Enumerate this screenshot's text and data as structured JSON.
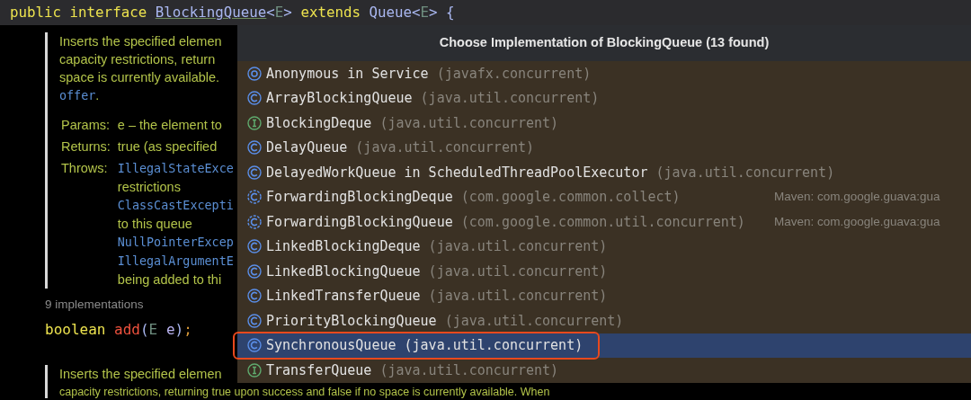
{
  "code_header": [
    {
      "t": "public interface ",
      "kind": "keyword"
    },
    {
      "t": "BlockingQueue",
      "kind": "type_link"
    },
    {
      "t": "<",
      "kind": "punct"
    },
    {
      "t": "E",
      "kind": "typeparam"
    },
    {
      "t": "> ",
      "kind": "punct"
    },
    {
      "t": "extends ",
      "kind": "keyword"
    },
    {
      "t": "Queue",
      "kind": "type"
    },
    {
      "t": "<",
      "kind": "punct"
    },
    {
      "t": "E",
      "kind": "typeparam"
    },
    {
      "t": "> {",
      "kind": "punct"
    }
  ],
  "doc_block": {
    "lines": [
      [
        {
          "t": "Inserts the specified elemen",
          "kind": "doc"
        }
      ],
      [
        {
          "t": "capacity restrictions, return",
          "kind": "doc"
        }
      ],
      [
        {
          "t": "space is currently available.",
          "kind": "doc"
        }
      ],
      [
        {
          "t": "offer",
          "kind": "code"
        },
        {
          "t": ".",
          "kind": "doc"
        }
      ]
    ],
    "tags": [
      {
        "label": "Params:",
        "lines": [
          [
            {
              "t": "e – the element to",
              "kind": "doc"
            }
          ]
        ]
      },
      {
        "label": "Returns:",
        "lines": [
          [
            {
              "t": "true (as specified",
              "kind": "doc"
            }
          ]
        ]
      },
      {
        "label": "Throws:",
        "lines": [
          [
            {
              "t": "IllegalStateExce",
              "kind": "code"
            }
          ],
          [
            {
              "t": "restrictions",
              "kind": "doc"
            }
          ],
          [
            {
              "t": "ClassCastExcepti",
              "kind": "code"
            }
          ],
          [
            {
              "t": "to this queue",
              "kind": "doc"
            }
          ],
          [
            {
              "t": "NullPointerExcep",
              "kind": "code"
            }
          ],
          [
            {
              "t": "IllegalArgumentE",
              "kind": "code"
            }
          ],
          [
            {
              "t": "being added to thi",
              "kind": "doc"
            }
          ]
        ]
      }
    ]
  },
  "implementations_hint": "9 implementations",
  "method_line": [
    {
      "t": "boolean ",
      "kind": "keyword"
    },
    {
      "t": "add",
      "kind": "method"
    },
    {
      "t": "(",
      "kind": "paren"
    },
    {
      "t": "E",
      "kind": "typeparam"
    },
    {
      "t": " e",
      "kind": "param"
    },
    {
      "t": ")",
      "kind": "paren"
    },
    {
      "t": ";",
      "kind": "semi"
    }
  ],
  "doc_block_2": {
    "lines": [
      [
        {
          "t": "Inserts the specified elemen",
          "kind": "doc"
        }
      ],
      [
        {
          "t": "capacity restrictions, returning true upon success and false if no space is currently available. When",
          "kind": "doc"
        }
      ]
    ]
  },
  "popup": {
    "title": "Choose Implementation of BlockingQueue (13 found)",
    "items": [
      {
        "kind": "anonymous",
        "name": "Anonymous in Service",
        "package": "(javafx.concurrent)",
        "selected": false,
        "outlined": false
      },
      {
        "kind": "class",
        "name": "ArrayBlockingQueue",
        "package": "(java.util.concurrent)",
        "selected": false,
        "outlined": false
      },
      {
        "kind": "interface",
        "name": "BlockingDeque",
        "package": "(java.util.concurrent)",
        "selected": false,
        "outlined": false
      },
      {
        "kind": "class",
        "name": "DelayQueue",
        "package": "(java.util.concurrent)",
        "selected": false,
        "outlined": false
      },
      {
        "kind": "class",
        "name": "DelayedWorkQueue in ScheduledThreadPoolExecutor",
        "package": "(java.util.concurrent)",
        "selected": false,
        "outlined": false
      },
      {
        "kind": "abstract",
        "name": "ForwardingBlockingDeque",
        "package": "(com.google.common.collect)",
        "location": "Maven: com.google.guava:gua",
        "selected": false,
        "outlined": false
      },
      {
        "kind": "abstract",
        "name": "ForwardingBlockingQueue",
        "package": "(com.google.common.util.concurrent)",
        "location": "Maven: com.google.guava:gua",
        "selected": false,
        "outlined": false
      },
      {
        "kind": "class",
        "name": "LinkedBlockingDeque",
        "package": "(java.util.concurrent)",
        "selected": false,
        "outlined": false
      },
      {
        "kind": "class",
        "name": "LinkedBlockingQueue",
        "package": "(java.util.concurrent)",
        "selected": false,
        "outlined": false
      },
      {
        "kind": "class",
        "name": "LinkedTransferQueue",
        "package": "(java.util.concurrent)",
        "selected": false,
        "outlined": false
      },
      {
        "kind": "class",
        "name": "PriorityBlockingQueue",
        "package": "(java.util.concurrent)",
        "selected": false,
        "outlined": false
      },
      {
        "kind": "class",
        "name": "SynchronousQueue",
        "package": "(java.util.concurrent)",
        "selected": true,
        "outlined": true
      },
      {
        "kind": "interface",
        "name": "TransferQueue",
        "package": "(java.util.concurrent)",
        "selected": false,
        "outlined": false
      }
    ]
  }
}
